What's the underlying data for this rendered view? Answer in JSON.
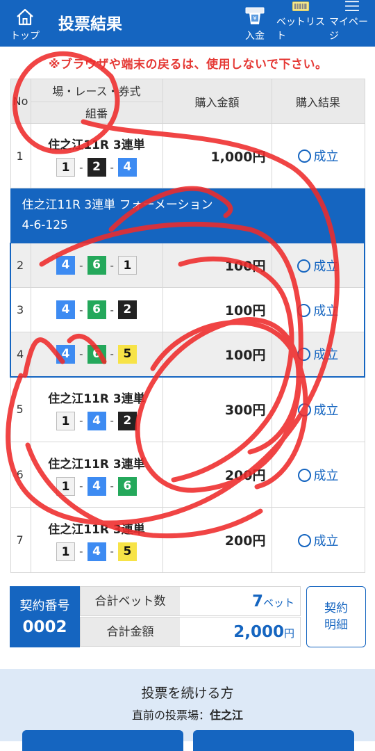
{
  "header": {
    "home_label": "トップ",
    "title": "投票結果",
    "deposit_label": "入金",
    "betlist_label": "ベットリスト",
    "mypage_label": "マイページ"
  },
  "warning": "※ブラウザや端末の戻るは、使用しないで下さい。",
  "table": {
    "headers": {
      "no": "No",
      "place": "場・レース・券式",
      "combo": "組番",
      "amount": "購入金額",
      "result": "購入結果"
    },
    "row1": {
      "no": "1",
      "race": "住之江11R 3連単",
      "combo": [
        "1",
        "2",
        "4"
      ],
      "amount": "1,000円",
      "result": "成立"
    },
    "formation": {
      "title": "住之江11R 3連単 フォーメーション",
      "combo": "4-6-125",
      "rows": [
        {
          "no": "2",
          "combo": [
            "4",
            "6",
            "1"
          ],
          "amount": "100円",
          "result": "成立"
        },
        {
          "no": "3",
          "combo": [
            "4",
            "6",
            "2"
          ],
          "amount": "100円",
          "result": "成立"
        },
        {
          "no": "4",
          "combo": [
            "4",
            "6",
            "5"
          ],
          "amount": "100円",
          "result": "成立"
        }
      ]
    },
    "rows": [
      {
        "no": "5",
        "race": "住之江11R 3連単",
        "combo": [
          "1",
          "4",
          "2"
        ],
        "amount": "300円",
        "result": "成立"
      },
      {
        "no": "6",
        "race": "住之江11R 3連単",
        "combo": [
          "1",
          "4",
          "6"
        ],
        "amount": "200円",
        "result": "成立"
      },
      {
        "no": "7",
        "race": "住之江11R 3連単",
        "combo": [
          "1",
          "4",
          "5"
        ],
        "amount": "200円",
        "result": "成立"
      }
    ]
  },
  "summary": {
    "contract_label": "契約番号",
    "contract_no": "0002",
    "bet_count_label": "合計ベット数",
    "bet_count": "7",
    "bet_unit": "ベット",
    "total_label": "合計金額",
    "total": "2,000",
    "total_unit": "円",
    "detail_line1": "契約",
    "detail_line2": "明細"
  },
  "continue": {
    "title": "投票を続ける方",
    "sub_label": "直前の投票場：",
    "sub_value": "住之江"
  },
  "colors": {
    "header_bg": "#1565c0",
    "warning": "#e53935",
    "boat1": "#f2f2f2",
    "boat2": "#222222",
    "boat4": "#3d8bf2",
    "boat5": "#f7e347",
    "boat6": "#24a85b",
    "scribble": "#ee2b2b"
  }
}
